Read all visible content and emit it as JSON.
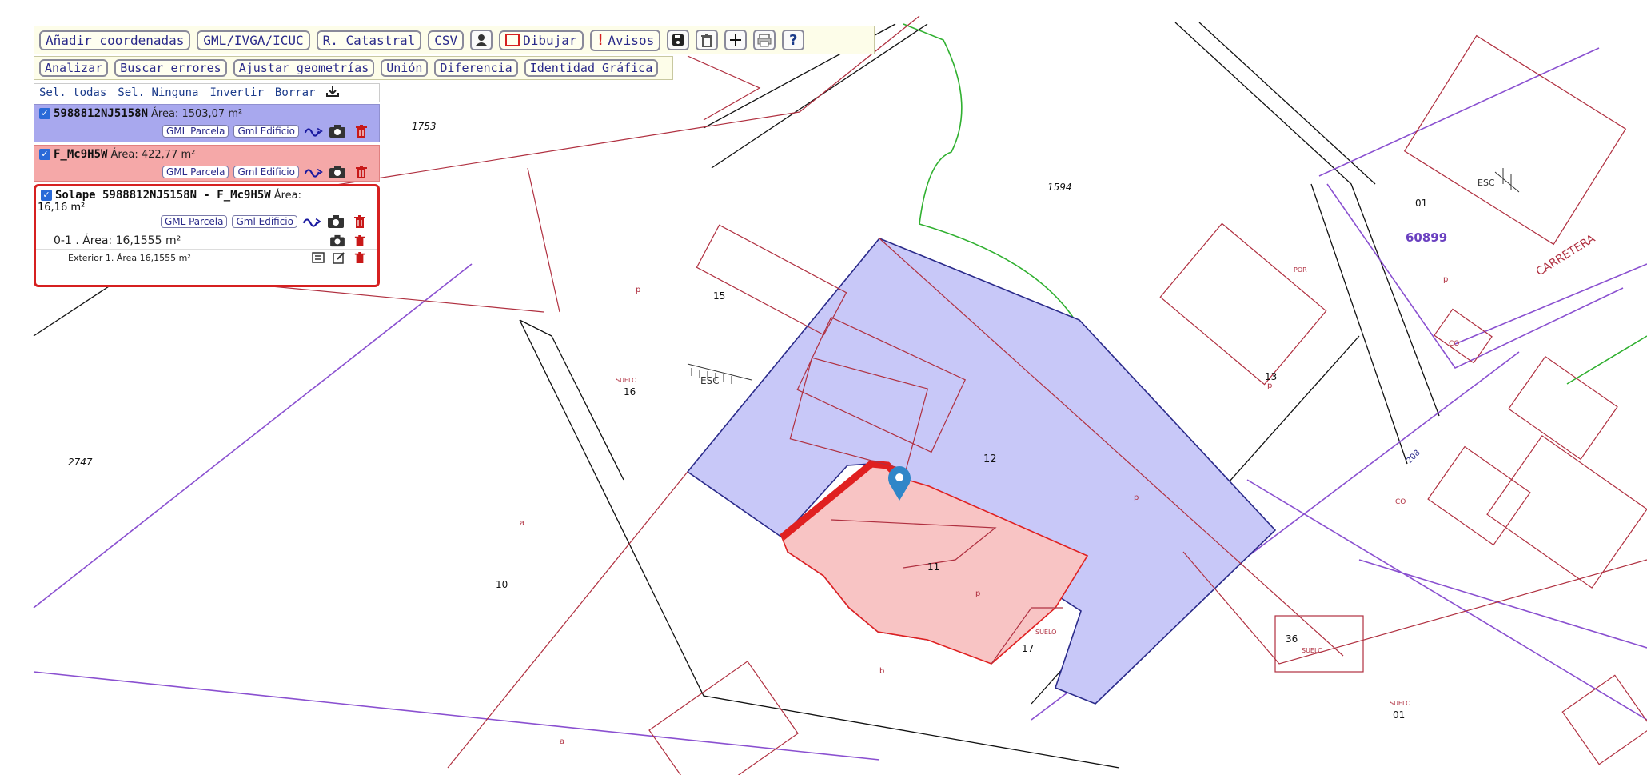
{
  "toolbar1": {
    "add_coords": "Añadir coordenadas",
    "gml": "GML/IVGA/ICUC",
    "catastral": "R. Catastral",
    "csv": "CSV",
    "draw": "Dibujar",
    "warnings": "Avisos"
  },
  "toolbar2": {
    "analyze": "Analizar",
    "find_errors": "Buscar errores",
    "adjust": "Ajustar geometrías",
    "union": "Unión",
    "difference": "Diferencia",
    "identity": "Identidad Gráfica"
  },
  "selection": {
    "select_all": "Sel. todas",
    "select_none": "Sel. Ninguna",
    "invert": "Invertir",
    "delete": "Borrar"
  },
  "layers": [
    {
      "name": "5988812NJ5158N",
      "area_label": "Área: 1503,07 m²",
      "gml_parcel": "GML Parcela",
      "gml_building": "Gml Edificio"
    },
    {
      "name": "F_Mc9H5W",
      "area_label": "Área: 422,77 m²",
      "gml_parcel": "GML Parcela",
      "gml_building": "Gml Edificio"
    }
  ],
  "overlap": {
    "name": "Solape 5988812NJ5158N - F_Mc9H5W",
    "area_label": "Área:",
    "area_value": "16,16 m²",
    "gml_parcel": "GML Parcela",
    "gml_building": "Gml Edificio",
    "part_label": "0-1 . Área: 16,1555 m²",
    "exterior_label": "Exterior 1. Área 16,1555 m²"
  },
  "map_labels": {
    "n1753": "1753",
    "n1594": "1594",
    "n2747": "2747",
    "n01a": "01",
    "n60899": "60899",
    "carretera": "CARRETERA",
    "esc1": "ESC",
    "esc2": "ESC",
    "suelo1": "SUELO",
    "n16": "16",
    "n15": "15",
    "n13": "13",
    "n12": "12",
    "n11": "11",
    "n10": "10",
    "suelo2": "SUELO",
    "n17": "17",
    "n36": "36",
    "suelo3": "SUELO",
    "suelo4": "SUELO",
    "n01b": "01",
    "n208": "208",
    "a1": "a",
    "a2": "a",
    "b1": "b",
    "p1": "p",
    "p2": "p",
    "p3": "p",
    "p4": "p",
    "p5": "p",
    "co1": "CO",
    "co2": "CO",
    "por": "POR"
  },
  "colors": {
    "parcel_fill": "#c8c8f8",
    "overlap_fill": "#f8c4c4",
    "overlap_edge": "#e02020",
    "cadastre_line": "#b03040",
    "boundary_line": "#8a50d0",
    "green_line": "#30b030",
    "marker": "#2f86c8"
  }
}
